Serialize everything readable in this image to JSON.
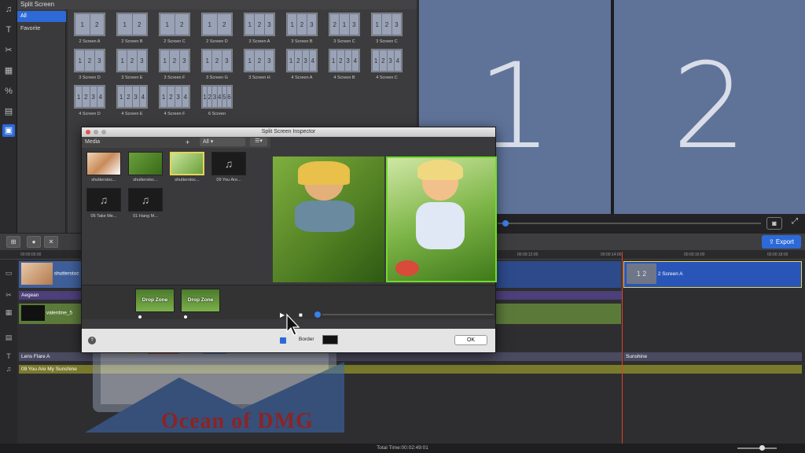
{
  "panel": {
    "title": "Split Screen"
  },
  "categories": [
    {
      "label": "All",
      "selected": true
    },
    {
      "label": "Favorite",
      "selected": false
    }
  ],
  "templates": [
    {
      "label": "2 Screen A",
      "cells": [
        "1",
        "2"
      ]
    },
    {
      "label": "2 Screen B",
      "cells": [
        "1",
        "2"
      ]
    },
    {
      "label": "2 Screen C",
      "cells": [
        "1",
        "2"
      ]
    },
    {
      "label": "2 Screen D",
      "cells": [
        "1",
        "2"
      ]
    },
    {
      "label": "3 Screen A",
      "cells": [
        "1",
        "2",
        "3"
      ]
    },
    {
      "label": "3 Screen B",
      "cells": [
        "1",
        "2",
        "3"
      ]
    },
    {
      "label": "3 Screen C",
      "cells": [
        "2",
        "1",
        "3"
      ]
    },
    {
      "label": "3 Screen C",
      "cells": [
        "1",
        "2",
        "3"
      ]
    },
    {
      "label": "3 Screen D",
      "cells": [
        "1",
        "2",
        "3"
      ]
    },
    {
      "label": "3 Screen E",
      "cells": [
        "1",
        "2",
        "3"
      ]
    },
    {
      "label": "3 Screen F",
      "cells": [
        "1",
        "2",
        "3"
      ]
    },
    {
      "label": "3 Screen G",
      "cells": [
        "1",
        "2",
        "3"
      ]
    },
    {
      "label": "3 Screen H",
      "cells": [
        "1",
        "2",
        "3"
      ]
    },
    {
      "label": "4 Screen A",
      "cells": [
        "1",
        "2",
        "3",
        "4"
      ]
    },
    {
      "label": "4 Screen B",
      "cells": [
        "1",
        "2",
        "3",
        "4"
      ]
    },
    {
      "label": "4 Screen C",
      "cells": [
        "1",
        "2",
        "3",
        "4"
      ]
    },
    {
      "label": "4 Screen D",
      "cells": [
        "1",
        "2",
        "3",
        "4"
      ]
    },
    {
      "label": "4 Screen E",
      "cells": [
        "1",
        "2",
        "3",
        "4"
      ]
    },
    {
      "label": "4 Screen F",
      "cells": [
        "1",
        "2",
        "3",
        "4"
      ]
    },
    {
      "label": "6 Screen",
      "cells": [
        "1",
        "2",
        "3",
        "4",
        "5",
        "6"
      ]
    }
  ],
  "preview": {
    "left_number": "1",
    "right_number": "2"
  },
  "timeline": {
    "export_label": "Export",
    "ruler_ticks": [
      "00:00:00:00",
      "00:00:12:00",
      "00:00:14:00",
      "00:00:16:00",
      "00:00:18:00"
    ],
    "clips": {
      "video1": "shutterstoc",
      "split_clip": "2 Screen A",
      "text1": "Aegean",
      "video2": "valentine_5",
      "effect": "Lens Flare A",
      "effect2": "Sunshine",
      "audio": "09 You Are My Sunshine"
    }
  },
  "status": {
    "total_time": "Total Time:00:02:49:01"
  },
  "inspector": {
    "title": "Split Screen Inspector",
    "media_label": "Media",
    "add_label": "+",
    "filter_value": "All",
    "media": [
      {
        "label": "shutterstoc...",
        "kind": "video"
      },
      {
        "label": "shutterstoc...",
        "kind": "video"
      },
      {
        "label": "shutterstoc...",
        "kind": "video"
      },
      {
        "label": "09 You Are...",
        "kind": "audio"
      },
      {
        "label": "06 Take Me...",
        "kind": "audio"
      },
      {
        "label": "01 Hang M...",
        "kind": "audio"
      }
    ],
    "drop_zone_label": "Drop Zone",
    "border_label": "Border",
    "ok_label": "OK",
    "help_label": "?"
  },
  "watermark": "Ocean of DMG",
  "colors": {
    "accent": "#2d6ad8",
    "playhead": "#e0402a",
    "preview_bg": "#5f7399"
  }
}
